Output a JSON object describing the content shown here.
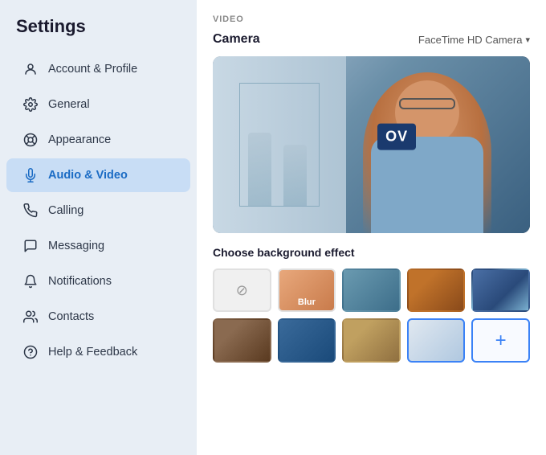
{
  "sidebar": {
    "title": "Settings",
    "items": [
      {
        "id": "account",
        "label": "Account & Profile",
        "icon": "person"
      },
      {
        "id": "general",
        "label": "General",
        "icon": "gear"
      },
      {
        "id": "appearance",
        "label": "Appearance",
        "icon": "appearance"
      },
      {
        "id": "audio-video",
        "label": "Audio & Video",
        "icon": "mic",
        "active": true
      },
      {
        "id": "calling",
        "label": "Calling",
        "icon": "phone"
      },
      {
        "id": "messaging",
        "label": "Messaging",
        "icon": "message"
      },
      {
        "id": "notifications",
        "label": "Notifications",
        "icon": "bell"
      },
      {
        "id": "contacts",
        "label": "Contacts",
        "icon": "contact"
      },
      {
        "id": "help",
        "label": "Help & Feedback",
        "icon": "help"
      }
    ]
  },
  "main": {
    "section_label": "VIDEO",
    "camera_label": "Camera",
    "camera_device": "FaceTime HD Camera",
    "bg_effect_label": "Choose background effect",
    "ov_badge": "OV",
    "thumbs": [
      {
        "id": "none",
        "type": "none",
        "label": ""
      },
      {
        "id": "blur",
        "type": "blur",
        "label": "Blur"
      },
      {
        "id": "t1",
        "type": "color",
        "color_class": "t1",
        "label": ""
      },
      {
        "id": "t2",
        "type": "color",
        "color_class": "t2",
        "label": ""
      },
      {
        "id": "t3",
        "type": "color",
        "color_class": "t3",
        "label": ""
      },
      {
        "id": "t4",
        "type": "color",
        "color_class": "t4",
        "label": ""
      },
      {
        "id": "t5",
        "type": "color",
        "color_class": "t5",
        "label": ""
      },
      {
        "id": "t6",
        "type": "color",
        "color_class": "t6",
        "label": ""
      },
      {
        "id": "t7",
        "type": "color",
        "color_class": "t7",
        "selected": true,
        "label": ""
      },
      {
        "id": "add",
        "type": "add",
        "label": ""
      }
    ]
  }
}
